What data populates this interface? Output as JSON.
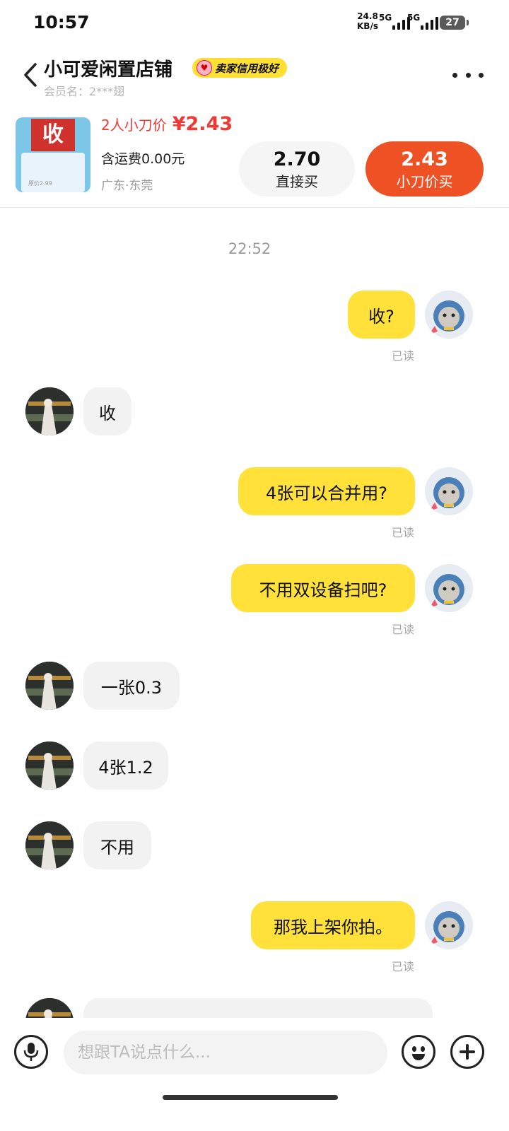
{
  "status_bar": {
    "time": "10:57",
    "net_speed_value": "24.8",
    "net_speed_unit": "KB/s",
    "sim1_label": "5G",
    "sim2_label": "5G",
    "battery": "27"
  },
  "header": {
    "shop_name": "小可爱闲置店铺",
    "credit_badge": "卖家信用极好",
    "member_label": "会员名：2***翅",
    "icons": [
      "back-icon",
      "more-icon"
    ]
  },
  "product": {
    "thumb_label": "收",
    "thumb_sub": "原价2.99",
    "bargain_text": "2人小刀价",
    "bargain_price": "¥2.43",
    "shipping": "含运费0.00元",
    "location": "广东·东莞",
    "direct_price": "2.70",
    "direct_label": "直接买",
    "knife_price": "2.43",
    "knife_label": "小刀价买",
    "accent_color": "#ee5124"
  },
  "chat": {
    "timestamp": "22:52",
    "read_label": "已读",
    "messages": [
      {
        "from": "me",
        "text": "收?"
      },
      {
        "from": "other",
        "text": "收"
      },
      {
        "from": "me",
        "text": "4张可以合并用?"
      },
      {
        "from": "me",
        "text": "不用双设备扫吧?"
      },
      {
        "from": "other",
        "text": "一张0.3"
      },
      {
        "from": "other",
        "text": "4张1.2"
      },
      {
        "from": "other",
        "text": "不用"
      },
      {
        "from": "me",
        "text": "那我上架你拍。"
      }
    ]
  },
  "input": {
    "placeholder": "想跟TA说点什么...",
    "icons": [
      "mic-icon",
      "emoji-icon",
      "plus-icon"
    ]
  }
}
